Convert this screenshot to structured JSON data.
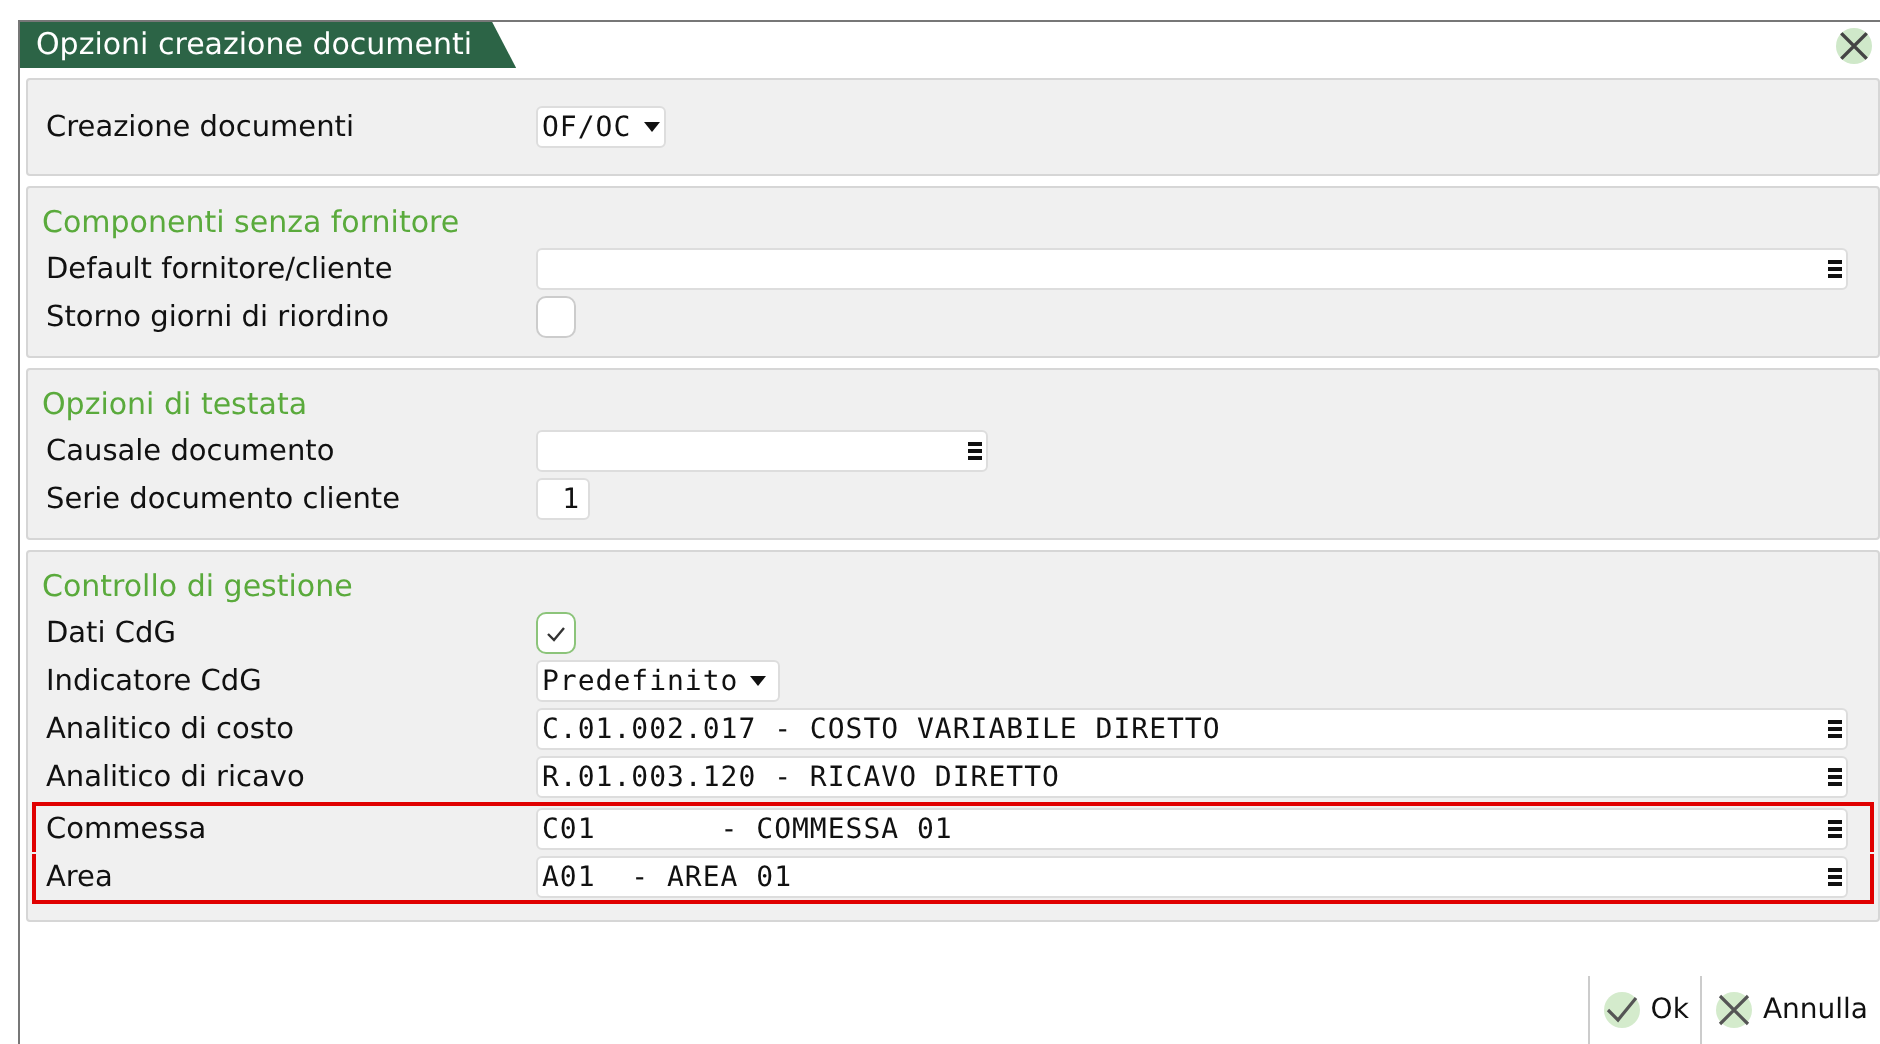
{
  "window": {
    "title": "Opzioni creazione documenti"
  },
  "sections": [
    {
      "rows": [
        {
          "label": "Creazione documenti",
          "kind": "dropdown",
          "value": "OF/OC",
          "highlighted": false
        }
      ]
    },
    {
      "title": "Componenti senza fornitore",
      "rows": [
        {
          "label": "Default fornitore/cliente",
          "kind": "lookup",
          "value": "",
          "highlighted": false
        },
        {
          "label": "Storno giorni di riordino",
          "kind": "checkbox",
          "checked": false,
          "highlighted": false
        }
      ]
    },
    {
      "title": "Opzioni di testata",
      "rows": [
        {
          "label": "Causale documento",
          "kind": "code",
          "value": "",
          "highlighted": false
        },
        {
          "label": "Serie documento cliente",
          "kind": "number",
          "value": "1",
          "highlighted": false
        }
      ]
    },
    {
      "title": "Controllo di gestione",
      "rows": [
        {
          "label": "Dati CdG",
          "kind": "checkbox",
          "checked": true,
          "highlighted": false
        },
        {
          "label": "Indicatore CdG",
          "kind": "dropdown",
          "value": "Predefinito",
          "highlighted": false
        },
        {
          "label": "Analitico di costo",
          "kind": "lookup",
          "value": "C.01.002.017 - COSTO VARIABILE DIRETTO",
          "highlighted": false
        },
        {
          "label": "Analitico di ricavo",
          "kind": "lookup",
          "value": "R.01.003.120 - RICAVO DIRETTO",
          "highlighted": false
        },
        {
          "label": "Commessa",
          "kind": "lookup",
          "value": "C01       - COMMESSA 01",
          "highlighted": true
        },
        {
          "label": "Area",
          "kind": "lookup",
          "value": "A01  - AREA 01",
          "highlighted": true
        }
      ]
    }
  ],
  "buttons": [
    {
      "label": "Ok",
      "kind": "confirm"
    },
    {
      "label": "Annulla",
      "kind": "cancel"
    }
  ]
}
